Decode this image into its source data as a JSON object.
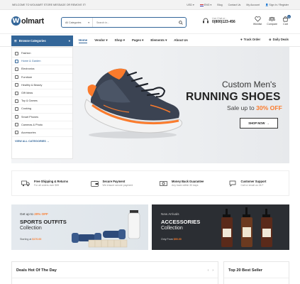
{
  "topbar": {
    "welcome": "WELCOME TO WOLMART STORE MESSAGE OR REMOVE IT!",
    "currency": "USD",
    "language": "ENG",
    "links": [
      "Blog",
      "Contact Us",
      "My Account",
      "Sign In / Register"
    ]
  },
  "header": {
    "logo": "olmart",
    "logo_mark": "W",
    "search": {
      "category": "All Categories",
      "placeholder": "Search in..."
    },
    "phone": {
      "label": "Live Chat or :",
      "number": "0(800)123-456"
    },
    "icons": [
      {
        "label": "Wishlist",
        "icon": "heart-icon"
      },
      {
        "label": "Compare",
        "icon": "compare-icon"
      },
      {
        "label": "Cart",
        "icon": "cart-icon",
        "badge": "0"
      }
    ]
  },
  "nav": {
    "browse": "Browse Categories",
    "menu": [
      {
        "label": "Home",
        "active": true
      },
      {
        "label": "Vendor",
        "caret": true
      },
      {
        "label": "Shop",
        "caret": true
      },
      {
        "label": "Pages",
        "caret": true
      },
      {
        "label": "Elements",
        "caret": true
      },
      {
        "label": "About Us"
      }
    ],
    "track_order": "Track Order",
    "daily_deals": "Daily Deals"
  },
  "sidebar": {
    "items": [
      "Fashion",
      "Home & Garden",
      "Electronics",
      "Furniture",
      "Healthy & Beauty",
      "Gift Ideas",
      "Toy & Games",
      "Cooking",
      "Smart Phones",
      "Cameras & Photo",
      "Accessories"
    ],
    "highlighted": 1,
    "view_all": "VIEW ALL CATEGORIES"
  },
  "hero": {
    "subtitle": "Custom Men's",
    "title": "RUNNING SHOES",
    "sale_prefix": "Sale up to",
    "sale_value": "30% OFF",
    "button": "SHOP NOW",
    "accent": "#fb7b2c"
  },
  "features": [
    {
      "title": "Free Shipping & Returns",
      "sub": "For all orders over $99",
      "icon": "truck-icon"
    },
    {
      "title": "Secure Payment",
      "sub": "We ensure secure payment",
      "icon": "wallet-icon"
    },
    {
      "title": "Money Back Guarantee",
      "sub": "Any back within 30 days",
      "icon": "money-icon"
    },
    {
      "title": "Customer Support",
      "sub": "Call or email us 24/7",
      "icon": "chat-icon"
    }
  ],
  "banner_sports": {
    "get_prefix": "Get up to",
    "get_value": "20% OFF",
    "title": "SPORTS OUTFITS",
    "collection": "Collection",
    "start_prefix": "Starting at",
    "start_value": "$170.00"
  },
  "banner_accessories": {
    "new": "New Arrivals",
    "title": "ACCESSORIES",
    "collection": "Collection",
    "only_prefix": "Only From",
    "only_value": "$90.00"
  },
  "deals": {
    "title": "Deals Hot Of The Day"
  },
  "top_seller": {
    "title": "Top 20 Best Seller"
  },
  "colors": {
    "primary": "#336699",
    "accent": "#fb7b2c"
  }
}
